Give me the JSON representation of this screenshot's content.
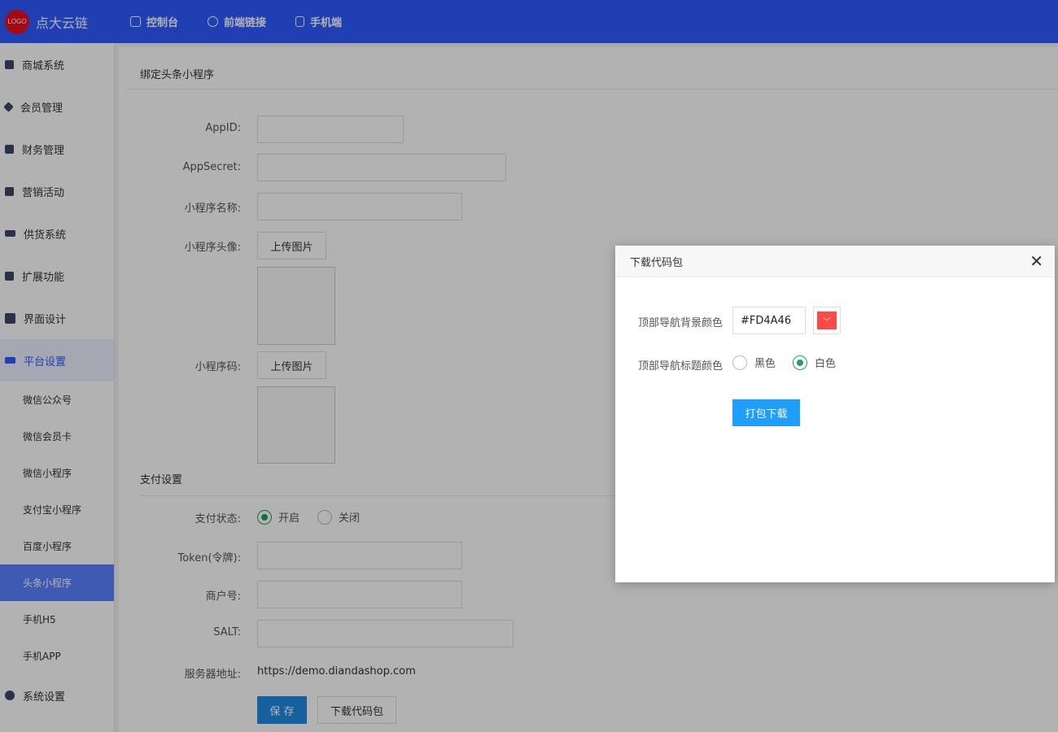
{
  "header": {
    "logo_text": "LOGO",
    "brand": "点大云链",
    "nav": [
      {
        "label": "控制台",
        "icon": "dashboard-icon"
      },
      {
        "label": "前端链接",
        "icon": "link-icon"
      },
      {
        "label": "手机端",
        "icon": "phone-icon"
      }
    ]
  },
  "sidebar": {
    "items": [
      {
        "label": "商城系统",
        "icon": "shop-bag-icon"
      },
      {
        "label": "会员管理",
        "icon": "diamond-icon"
      },
      {
        "label": "财务管理",
        "icon": "finance-icon"
      },
      {
        "label": "营销活动",
        "icon": "gift-icon"
      },
      {
        "label": "供货系统",
        "icon": "truck-icon"
      },
      {
        "label": "扩展功能",
        "icon": "puzzle-icon"
      },
      {
        "label": "界面设计",
        "icon": "layout-icon"
      },
      {
        "label": "平台设置",
        "icon": "platform-icon"
      }
    ],
    "sub_items": [
      {
        "label": "微信公众号"
      },
      {
        "label": "微信会员卡"
      },
      {
        "label": "微信小程序"
      },
      {
        "label": "支付宝小程序"
      },
      {
        "label": "百度小程序"
      },
      {
        "label": "头条小程序"
      },
      {
        "label": "手机H5"
      },
      {
        "label": "手机APP"
      }
    ],
    "bottom_item": {
      "label": "系统设置",
      "icon": "gear-icon"
    }
  },
  "form": {
    "section1_title": "绑定头条小程序",
    "appid_label": "AppID:",
    "appsecret_label": "AppSecret:",
    "name_label": "小程序名称:",
    "avatar_label": "小程序头像:",
    "code_label": "小程序码:",
    "upload_label": "上传图片",
    "section2_title": "支付设置",
    "pay_status_label": "支付状态:",
    "pay_on": "开启",
    "pay_off": "关闭",
    "token_label": "Token(令牌):",
    "merchant_label": "商户号:",
    "salt_label": "SALT:",
    "server_label": "服务器地址:",
    "server_value": "https://demo.diandashop.com",
    "save_label": "保 存",
    "download_label": "下载代码包"
  },
  "modal": {
    "title": "下载代码包",
    "bg_color_label": "顶部导航背景颜色",
    "bg_color_value": "#FD4A46",
    "title_color_label": "顶部导航标题颜色",
    "option_black": "黑色",
    "option_white": "白色",
    "submit_label": "打包下载"
  },
  "colors": {
    "header_bg": "#2d5bff",
    "swatch": "#FD4A46",
    "primary_button": "#1e9fff"
  }
}
